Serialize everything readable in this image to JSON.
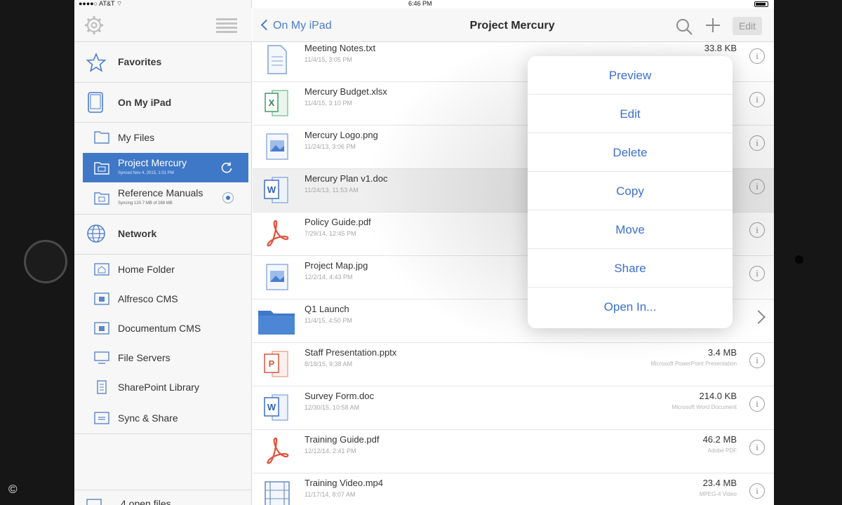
{
  "status_bar": {
    "carrier": "●●●●○ AT&T ⌔",
    "time": "6:46 PM"
  },
  "sidebar": {
    "icons": {
      "settings": "gear-icon",
      "view_toggle": "list-icon"
    },
    "sections": {
      "favorites": "Favorites",
      "on_my_ipad": "On My iPad",
      "network": "Network"
    },
    "local_items": [
      {
        "label": "My Files"
      },
      {
        "label": "Project Mercury",
        "sub": "Synced Nov 4, 2015, 1:01 PM"
      },
      {
        "label": "Reference Manuals",
        "sub": "Syncing 120.7 MB of 288 MB"
      }
    ],
    "network_items": [
      {
        "label": "Home Folder"
      },
      {
        "label": "Alfresco CMS"
      },
      {
        "label": "Documentum CMS"
      },
      {
        "label": "File Servers"
      },
      {
        "label": "SharePoint Library"
      },
      {
        "label": "Sync & Share"
      }
    ],
    "footer": "4 open files"
  },
  "topbar": {
    "back_label": "On My iPad",
    "title": "Project Mercury",
    "edit_label": "Edit"
  },
  "files": [
    {
      "name": "Meeting Notes.txt",
      "date": "11/4/15, 3:05 PM",
      "size": "33.8 KB",
      "type": "",
      "icon": "text"
    },
    {
      "name": "Mercury Budget.xlsx",
      "date": "11/4/15, 3:10 PM",
      "size": "",
      "type": "",
      "icon": "excel"
    },
    {
      "name": "Mercury Logo.png",
      "date": "11/24/13, 3:06 PM",
      "size": "",
      "type": "",
      "icon": "image"
    },
    {
      "name": "Mercury Plan v1.doc",
      "date": "11/24/13, 11:53 AM",
      "size": "",
      "type": "",
      "icon": "word"
    },
    {
      "name": "Policy Guide.pdf",
      "date": "7/29/14, 12:45 PM",
      "size": "",
      "type": "",
      "icon": "pdf"
    },
    {
      "name": "Project Map.jpg",
      "date": "12/2/14, 4:43 PM",
      "size": "",
      "type": "",
      "icon": "image"
    },
    {
      "name": "Q1 Launch",
      "date": "11/4/15, 4:50 PM",
      "size": "",
      "type": "",
      "icon": "folder"
    },
    {
      "name": "Staff Presentation.pptx",
      "date": "8/18/15, 9:38 AM",
      "size": "3.4 MB",
      "type": "Microsoft PowerPoint Presentation",
      "icon": "powerpoint"
    },
    {
      "name": "Survey Form.doc",
      "date": "12/30/15, 10:58 AM",
      "size": "214.0 KB",
      "type": "Microsoft Word Document",
      "icon": "word"
    },
    {
      "name": "Training Guide.pdf",
      "date": "12/12/14, 2:41 PM",
      "size": "46.2 MB",
      "type": "Adobe PDF",
      "icon": "pdf"
    },
    {
      "name": "Training Video.mp4",
      "date": "11/17/14, 8:07 AM",
      "size": "23.4 MB",
      "type": "MPEG-4 Video",
      "icon": "video"
    }
  ],
  "popover": {
    "items": [
      "Preview",
      "Edit",
      "Delete",
      "Copy",
      "Move",
      "Share",
      "Open In..."
    ]
  },
  "colors": {
    "accent": "#3f78c7",
    "link": "#4a7cd0",
    "popover_text": "#3b6fd0"
  },
  "copyright": "©"
}
